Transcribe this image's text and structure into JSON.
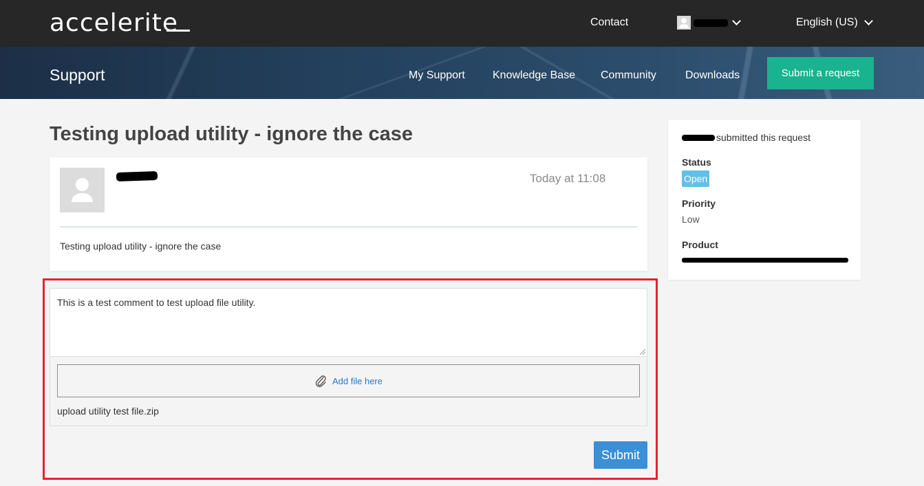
{
  "header": {
    "logo_text": "accelerite",
    "contact_label": "Contact",
    "user_name": "",
    "language_label": "English (US)"
  },
  "nav": {
    "section_title": "Support",
    "links": [
      "My Support",
      "Knowledge Base",
      "Community",
      "Downloads"
    ],
    "submit_request_label": "Submit a request"
  },
  "request": {
    "title": "Testing upload utility - ignore the case",
    "author": "",
    "timestamp": "Today at 11:08",
    "body": "Testing upload utility - ignore the case"
  },
  "comment": {
    "text": "This is a test comment to test upload file utility.",
    "add_file_label": "Add file here",
    "attached_file": "upload utility test file.zip",
    "submit_label": "Submit"
  },
  "sidebar": {
    "submitted_text": "submitted this request",
    "status_label": "Status",
    "status_value": "Open",
    "priority_label": "Priority",
    "priority_value": "Low",
    "product_label": "Product",
    "product_value": ""
  },
  "colors": {
    "topbar": "#272727",
    "accent_green": "#19b48f",
    "submit_blue": "#3b8fd6",
    "status_badge": "#61c0e8",
    "highlight_red": "#e3242b"
  },
  "icons": {
    "paperclip": "paperclip-icon",
    "user": "user-icon",
    "dropdown": "chevron-down-icon"
  }
}
